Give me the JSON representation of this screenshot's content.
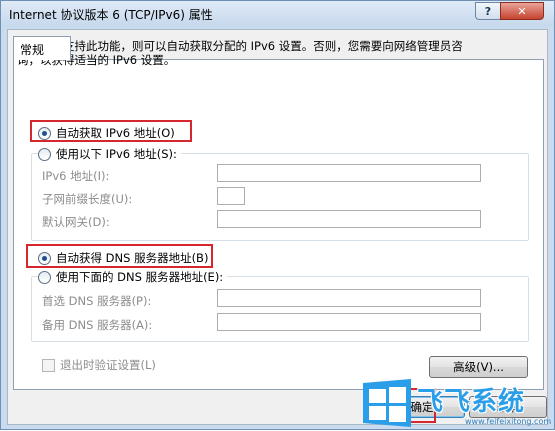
{
  "window": {
    "title": "Internet 协议版本 6 (TCP/IPv6) 属性",
    "help_glyph": "?",
    "close_glyph": "✕"
  },
  "tab": {
    "label": "常规"
  },
  "description": {
    "line1": "如果网络支持此功能，则可以自动获取分配的 IPv6 设置。否则，您需要向网络管理员咨",
    "line2": "询，以获得适当的 IPv6 设置。"
  },
  "ip": {
    "auto_label": "自动获取 IPv6 地址(O)",
    "manual_label": "使用以下 IPv6 地址(S):",
    "selected": "auto",
    "address_label": "IPv6 地址(I):",
    "prefix_label": "子网前缀长度(U):",
    "gateway_label": "默认网关(D):"
  },
  "dns": {
    "auto_label": "自动获得 DNS 服务器地址(B)",
    "manual_label": "使用下面的 DNS 服务器地址(E):",
    "selected": "auto",
    "preferred_label": "首选 DNS 服务器(P):",
    "alternate_label": "备用 DNS 服务器(A):"
  },
  "validate": {
    "label": "退出时验证设置(L)",
    "checked": false
  },
  "buttons": {
    "advanced": "高级(V)...",
    "ok": "确定",
    "cancel": "取消"
  },
  "watermark": {
    "brand": "飞飞系统",
    "url": "www.feifeixitong.com"
  },
  "colors": {
    "highlight": "#d6262e",
    "title_bar": "#c6d8ec",
    "close_button": "#c7432f",
    "watermark": "#2a9ee8"
  }
}
